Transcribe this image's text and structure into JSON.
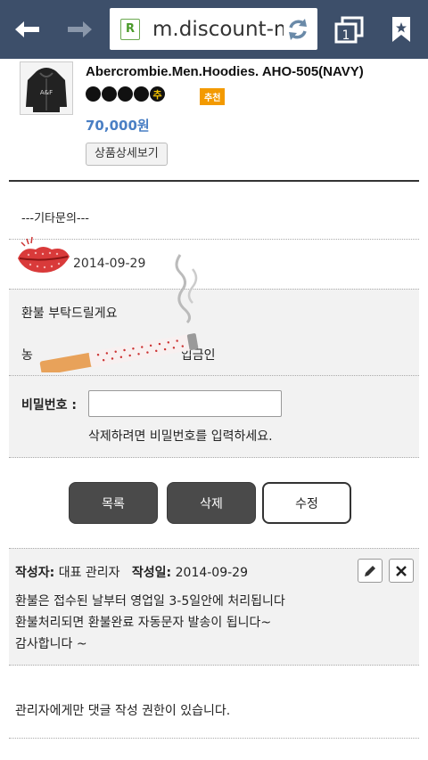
{
  "browser": {
    "url": "m.discount-m",
    "favicon_letter": "R"
  },
  "product": {
    "name": "Abercrombie.Men.Hoodies. AHO-505(NAVY)",
    "stars_last_char": "추",
    "rec_badge": "추천",
    "price": "70,000원",
    "detail_button": "상품상세보기"
  },
  "post": {
    "category": "---기타문의---",
    "date": "2014-09-29",
    "body_line1": "환불 부탁드릴게요",
    "body_line2_visible_start": "농",
    "body_line2_visible_end": "입금인",
    "password_label": "비밀번호 :",
    "password_value": "",
    "password_hint": "삭제하려면 비밀번호를 입력하세요."
  },
  "actions": {
    "list": "목록",
    "delete": "삭제",
    "edit": "수정"
  },
  "comment": {
    "author_label": "작성자:",
    "author": "대표 관리자",
    "date_label": "작성일:",
    "date": "2014-09-29",
    "lines": [
      "환불은 접수된 날부터 영업일 3-5일안에 처리됩니다",
      "환불처리되면 환불완료 자동문자 발송이 됩니다~",
      "감사합니다 ~"
    ]
  },
  "notice": "관리자에게만 댓글 작성 권한이 있습니다.",
  "icons": {
    "back": "arrow-left-icon",
    "forward": "arrow-right-icon",
    "reload": "reload-icon",
    "tabs": "tabs-icon",
    "bookmark": "bookmark-icon",
    "edit": "pencil-icon",
    "close": "close-icon"
  }
}
